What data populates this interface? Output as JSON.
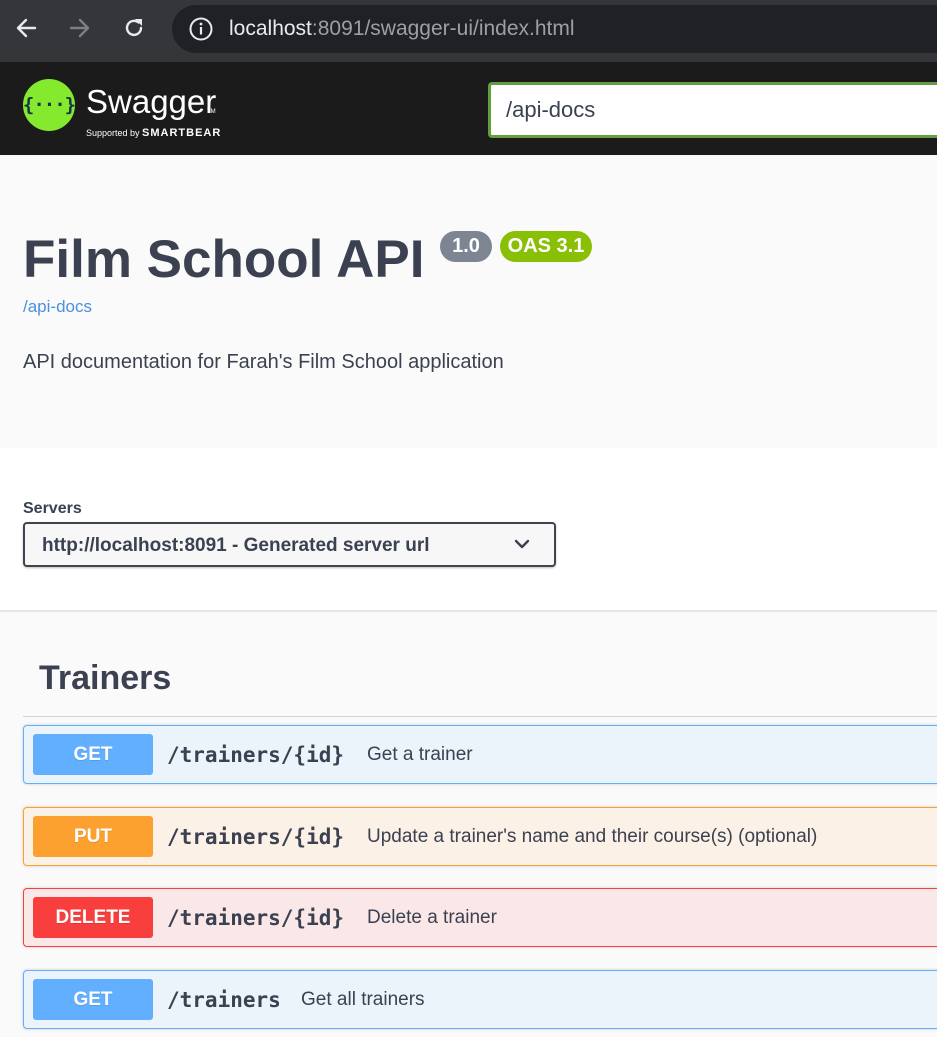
{
  "browser": {
    "url_host": "localhost",
    "url_rest": ":8091/swagger-ui/index.html"
  },
  "topbar": {
    "brand_name": "Swagger",
    "brand_tm": "TM",
    "brand_sub_prefix": "Supported by ",
    "brand_sub_company": "SMARTBEAR",
    "spec_url_value": "/api-docs"
  },
  "info": {
    "title": "Film School API",
    "version_badge": "1.0",
    "oas_badge": "OAS 3.1",
    "spec_link": "/api-docs",
    "description": "API documentation for Farah's Film School application"
  },
  "servers": {
    "label": "Servers",
    "selected": "http://localhost:8091 - Generated server url"
  },
  "tag": {
    "name": "Trainers"
  },
  "operations": [
    {
      "method": "GET",
      "path": "/trainers/{id}",
      "summary": "Get a trainer"
    },
    {
      "method": "PUT",
      "path": "/trainers/{id}",
      "summary": "Update a trainer's name and their course(s) (optional)"
    },
    {
      "method": "DELETE",
      "path": "/trainers/{id}",
      "summary": "Delete a trainer"
    },
    {
      "method": "GET",
      "path": "/trainers",
      "summary": "Get all trainers"
    }
  ],
  "colors": {
    "get": "#61affe",
    "put": "#fca130",
    "delete": "#f93e3e",
    "swagger_green": "#85ea2d",
    "oas_badge": "#89bf04",
    "version_badge": "#7d8492"
  }
}
